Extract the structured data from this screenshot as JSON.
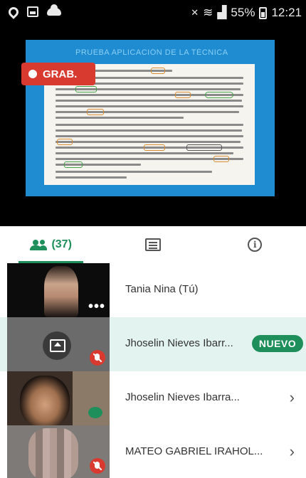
{
  "status_bar": {
    "signal_text": "⁴⁶",
    "battery_percent": "55%",
    "time": "12:21"
  },
  "presentation": {
    "recording_label": "GRAB.",
    "slide_title": "PRUEBA APLICACIÓN DE LA TÉCNICA"
  },
  "tabs": {
    "people_count": "(37)"
  },
  "participants": [
    {
      "name": "Tania Nina (Tú)"
    },
    {
      "name": "Jhoselin Nieves Ibarr...",
      "badge": "NUEVO"
    },
    {
      "name": "Jhoselin Nieves Ibarra..."
    },
    {
      "name": "MATEO GABRIEL IRAHOL..."
    }
  ],
  "colors": {
    "accent_green": "#1e8e5a",
    "record_red": "#d93a2f",
    "slide_blue": "#1f8bd0",
    "highlight_row": "#e3f4f0"
  }
}
